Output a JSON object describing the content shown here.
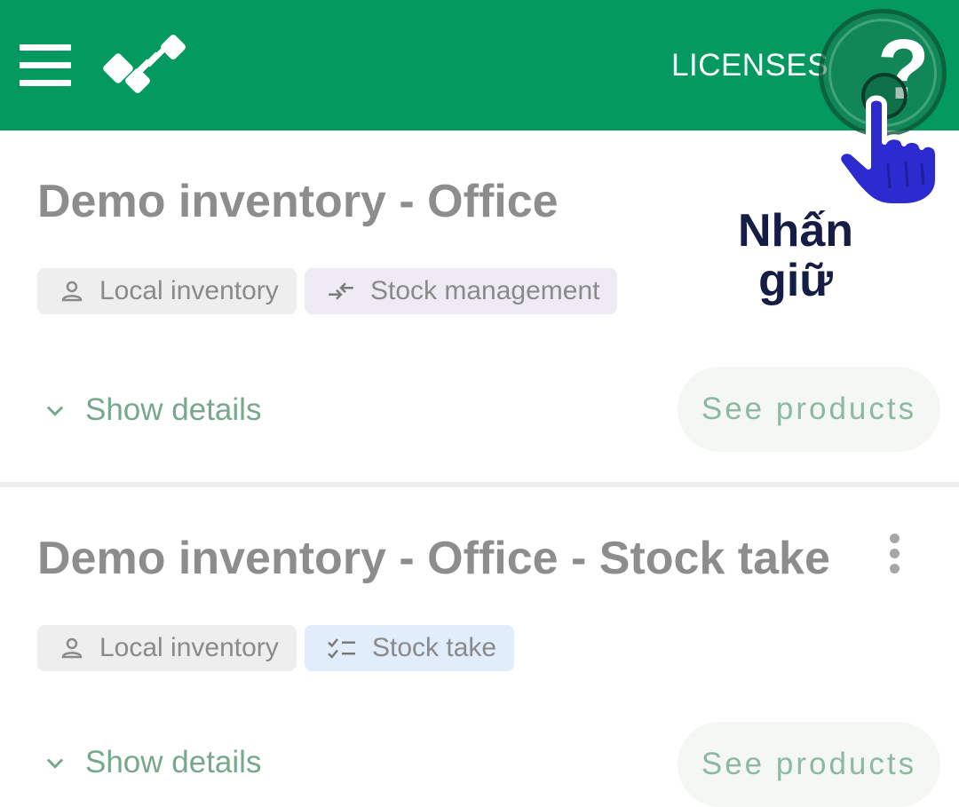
{
  "appbar": {
    "background": "#04995f",
    "menu_icon": "hamburger-menu-icon",
    "logo_icon": "app-logo",
    "licenses_label": "LICENSES",
    "help_label": "?",
    "help_icon": "help-icon"
  },
  "overlay": {
    "hint_text": "Nhấn giữ",
    "hand_icon": "pointing-hand-icon"
  },
  "cards": [
    {
      "title": "Demo inventory - Office",
      "chips": [
        {
          "label": "Local inventory",
          "icon": "person-icon"
        },
        {
          "label": "Stock management",
          "icon": "swap-arrows-icon"
        }
      ],
      "show_details": "Show details",
      "see_products": "See products"
    },
    {
      "title": "Demo inventory - Office - Stock take",
      "chips": [
        {
          "label": "Local inventory",
          "icon": "person-icon"
        },
        {
          "label": "Stock take",
          "icon": "checklist-icon"
        }
      ],
      "show_details": "Show details",
      "see_products": "See products"
    }
  ],
  "colors": {
    "accent_green": "#04995f",
    "title_gray": "#8d8d8d",
    "link_green": "#76a88b",
    "hint_navy": "#151c45"
  }
}
